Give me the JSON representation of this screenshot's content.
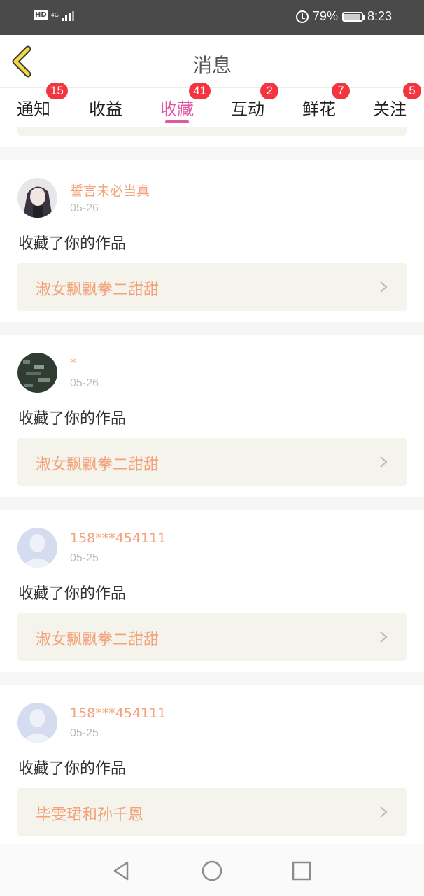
{
  "status_bar": {
    "hd": "HD",
    "network": "4G",
    "battery_percent": "79%",
    "time": "8:23"
  },
  "header": {
    "title": "消息"
  },
  "tabs": [
    {
      "label": "通知",
      "badge": "15",
      "active": false
    },
    {
      "label": "收益",
      "badge": "",
      "active": false
    },
    {
      "label": "收藏",
      "badge": "41",
      "active": true
    },
    {
      "label": "互动",
      "badge": "2",
      "active": false
    },
    {
      "label": "鲜花",
      "badge": "7",
      "active": false
    },
    {
      "label": "关注",
      "badge": "5",
      "active": false
    }
  ],
  "colors": {
    "accent": "#e05aa1",
    "badge": "#f2353f",
    "name": "#f3a27a"
  },
  "items": [
    {
      "username": "誓言未必当真",
      "date": "05-26",
      "action": "收藏了你的作品",
      "work": "淑女飘飘拳二甜甜",
      "avatar": "anime-avatar"
    },
    {
      "username": "*",
      "date": "05-26",
      "action": "收藏了你的作品",
      "work": "淑女飘飘拳二甜甜",
      "avatar": "dark-avatar"
    },
    {
      "username": "158***454111",
      "date": "05-25",
      "action": "收藏了你的作品",
      "work": "淑女飘飘拳二甜甜",
      "avatar": "default-avatar"
    },
    {
      "username": "158***454111",
      "date": "05-25",
      "action": "收藏了你的作品",
      "work": "毕雯珺和孙千恩",
      "avatar": "default-avatar"
    }
  ],
  "navbar": {
    "icons": [
      "back-triangle-icon",
      "home-circle-icon",
      "recents-square-icon"
    ]
  }
}
